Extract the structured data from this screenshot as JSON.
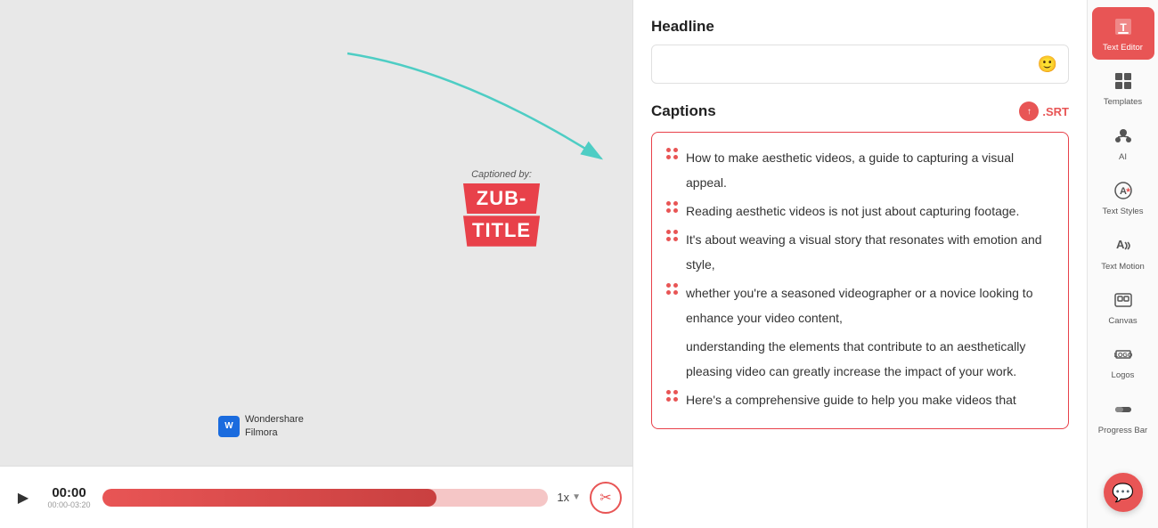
{
  "canvas": {
    "captioned_by": "Captioned by:",
    "subtitle_line1": "ZUB-",
    "subtitle_line2": "TITLE",
    "watermark_name": "Wondershare\nFilmora"
  },
  "timeline": {
    "play_icon": "▶",
    "time_current": "00:00",
    "time_range": "00:00-03:20",
    "speed": "1x",
    "progress_percent": 75
  },
  "editor": {
    "headline_section": "Headline",
    "headline_placeholder": "",
    "captions_section": "Captions",
    "srt_label": ".SRT",
    "caption_text": "How to make aesthetic videos, a guide to capturing a visual appeal. Reading aesthetic videos is not just about capturing footage. It's about weaving a visual story that resonates with emotion and style, whether you're a seasoned videographer or a novice looking to enhance your video content, understanding the elements that contribute to an aesthetically pleasing video can greatly increase the impact of your work. Here's a comprehensive guide to help you make videos that"
  },
  "sidebar": {
    "items": [
      {
        "label": "Text Editor",
        "active": true
      },
      {
        "label": "Templates",
        "active": false
      },
      {
        "label": "AI",
        "active": false
      },
      {
        "label": "Text Styles",
        "active": false
      },
      {
        "label": "Text Motion",
        "active": false
      },
      {
        "label": "Canvas",
        "active": false
      },
      {
        "label": "Logos",
        "active": false
      },
      {
        "label": "Progress Bar",
        "active": false
      }
    ]
  },
  "captions_lines": [
    {
      "text": "How to make aesthetic videos, a guide to capturing a visual appeal.",
      "has_dots": true
    },
    {
      "text": "Reading aesthetic videos is not just about capturing footage.",
      "has_dots": true
    },
    {
      "text": "It's about weaving a visual story that resonates with emotion and style,",
      "has_dots": true
    },
    {
      "text": "whether you're a seasoned videographer or a novice looking to enhance your video content,",
      "has_dots": true
    },
    {
      "text": "understanding the elements that contribute to an aesthetically pleasing video can greatly increase the impact of your work.",
      "has_dots": false
    },
    {
      "text": "Here's a comprehensive guide to help you make videos that",
      "has_dots": true
    }
  ]
}
